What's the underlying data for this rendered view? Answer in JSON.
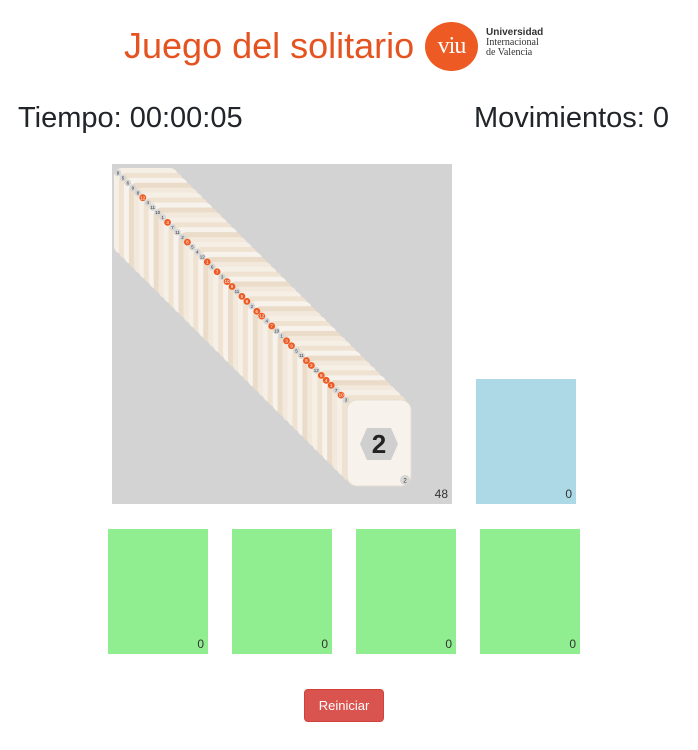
{
  "header": {
    "title": "Juego del solitario",
    "logo_mark": "viu",
    "logo_lines": [
      "Universidad",
      "Internacional",
      "de Valencia"
    ]
  },
  "stats": {
    "time_label": "Tiempo: 00:00:05",
    "moves_label": "Movimientos: 0"
  },
  "deck": {
    "count": "48",
    "top_card_number": "2",
    "top_card_corner": "2",
    "card_numbers": [
      "9",
      "5",
      "6",
      "9",
      "8",
      "12",
      "4",
      "11",
      "10",
      "1",
      "3",
      "7",
      "11",
      "2",
      "8",
      "5",
      "4",
      "12",
      "1",
      "6",
      "7",
      "3",
      "10",
      "9",
      "11",
      "5",
      "8",
      "2",
      "6",
      "12",
      "4",
      "7",
      "10",
      "1",
      "3",
      "9",
      "5",
      "11",
      "8",
      "2",
      "12",
      "6",
      "4",
      "1",
      "7",
      "10",
      "3"
    ],
    "card_colors": [
      "gray",
      "gray",
      "gray",
      "gray",
      "gray",
      "orange",
      "gray",
      "gray",
      "gray",
      "gray",
      "orange",
      "gray",
      "gray",
      "gray",
      "orange",
      "gray",
      "gray",
      "gray",
      "orange",
      "gray",
      "orange",
      "gray",
      "orange",
      "orange",
      "gray",
      "orange",
      "orange",
      "gray",
      "orange",
      "orange",
      "gray",
      "orange",
      "gray",
      "gray",
      "orange",
      "orange",
      "gray",
      "gray",
      "orange",
      "orange",
      "gray",
      "orange",
      "orange",
      "orange",
      "gray",
      "orange",
      "gray"
    ]
  },
  "waste": {
    "count": "0"
  },
  "foundations": [
    {
      "count": "0"
    },
    {
      "count": "0"
    },
    {
      "count": "0"
    },
    {
      "count": "0"
    }
  ],
  "restart_label": "Reiniciar",
  "colors": {
    "title": "#e55321",
    "deck_bg": "#d3d3d3",
    "waste_bg": "#add8e6",
    "foundation_bg": "#90ee90",
    "button_bg": "#d9534f",
    "card_face": "#f7f3ec",
    "card_orange": "#ee5a24",
    "card_gray": "#d6d6d6"
  },
  "icons": {
    "card_badge": "hexagon",
    "logo": "viu-circle-logo"
  }
}
